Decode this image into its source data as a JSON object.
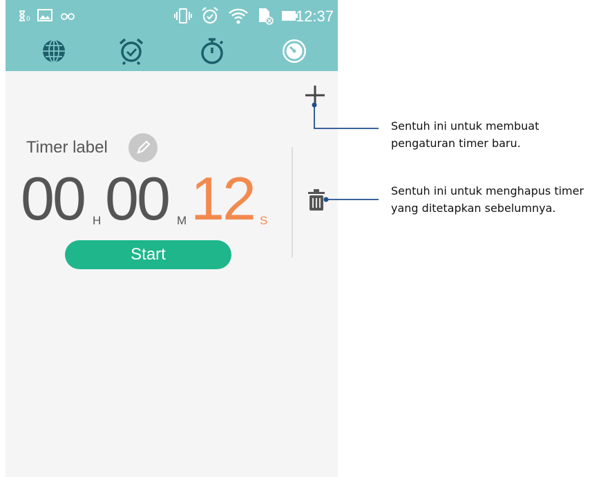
{
  "status_bar": {
    "time": "12:37"
  },
  "tabs": [
    {
      "icon": "globe-icon"
    },
    {
      "icon": "alarm-clock-icon"
    },
    {
      "icon": "stopwatch-icon"
    },
    {
      "icon": "timer-icon"
    }
  ],
  "timer": {
    "label": "Timer label",
    "hours": "00",
    "hours_unit": "H",
    "minutes": "00",
    "minutes_unit": "M",
    "seconds": "12",
    "seconds_unit": "S",
    "start_label": "Start"
  },
  "callouts": {
    "add": [
      "Sentuh ini untuk membuat",
      "pengaturan timer baru."
    ],
    "delete": [
      "Sentuh ini untuk menghapus timer",
      "yang ditetapkan sebelumnya."
    ]
  },
  "colors": {
    "accent_bar": "#7ec7c8",
    "start_button": "#1fb68c",
    "seconds": "#f28a50",
    "callout_line": "#1f4e8c"
  }
}
